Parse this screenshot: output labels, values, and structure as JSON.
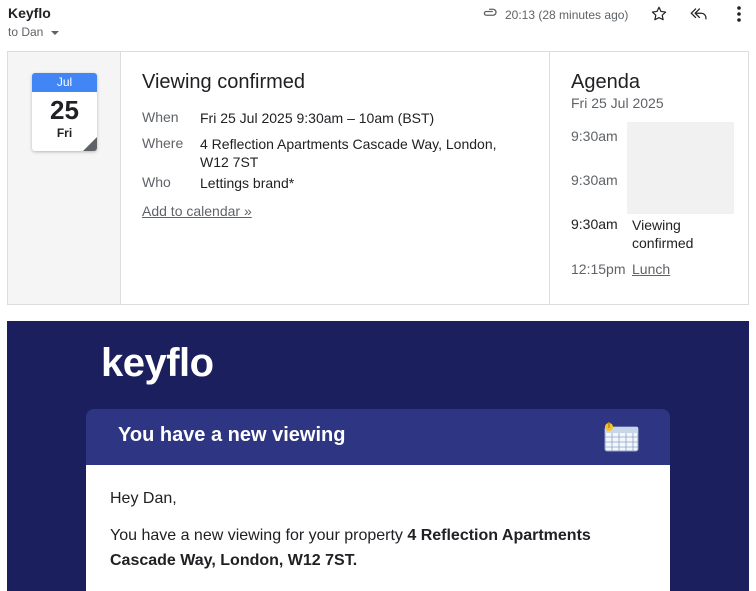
{
  "header": {
    "sender": "Keyflo",
    "to": "to Dan",
    "time": "20:13 (28 minutes ago)",
    "icons": [
      "attachment-icon",
      "star-icon",
      "reply-all-icon",
      "more-vert-icon"
    ]
  },
  "event_card": {
    "calendar": {
      "month": "Jul",
      "day": "25",
      "weekday": "Fri"
    },
    "title": "Viewing confirmed",
    "when_label": "When",
    "when_value": "Fri 25 Jul 2025 9:30am – 10am (BST)",
    "where_label": "Where",
    "where_value": "4 Reflection Apartments Cascade Way, London, W12 7ST",
    "who_label": "Who",
    "who_value": "Lettings brand*",
    "add_calendar": "Add to calendar »"
  },
  "agenda": {
    "title": "Agenda",
    "date": "Fri 25 Jul 2025",
    "items": [
      {
        "time": "9:30am",
        "label": ""
      },
      {
        "time": "9:30am",
        "label": ""
      },
      {
        "time": "9:30am",
        "label": "Viewing confirmed"
      },
      {
        "time": "12:15pm",
        "label": "Lunch"
      }
    ]
  },
  "promo": {
    "logo": "keyflo",
    "banner": "You have a new viewing",
    "greeting": "Hey Dan,",
    "message_prefix": "You have a new viewing for your property ",
    "message_bold": "4 Reflection Apartments Cascade Way, London, W12 7ST."
  },
  "colors": {
    "calendar_blue": "#4285f4",
    "promo_bg": "#1c1f5e",
    "banner_bg": "#2e3582"
  }
}
